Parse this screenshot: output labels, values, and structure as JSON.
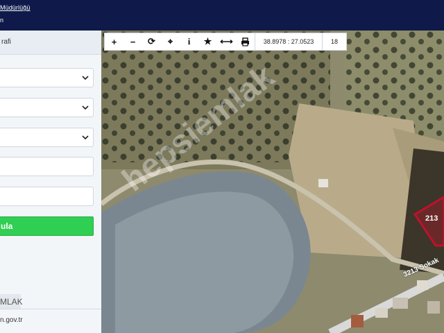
{
  "header": {
    "title": "Müdürlüğü",
    "subtitle": "n"
  },
  "sidebar": {
    "section_title": "rafi",
    "query_button": "ula",
    "brand": "MLAK",
    "site": "n.gov.tr"
  },
  "toolbar": {
    "zoom_in": "+",
    "zoom_out": "−",
    "refresh": "⟳",
    "locate": "⌖",
    "info": "i",
    "bookmark": "★",
    "measure": "⟷",
    "print": "🖶",
    "coordinates": "38.8978 : 27.0523",
    "zoom_level": "18"
  },
  "map": {
    "parcel_label": "213",
    "street_label": "3213 Sokak",
    "watermark": "hepsiemlak",
    "parcel_color": "#c0112a"
  }
}
